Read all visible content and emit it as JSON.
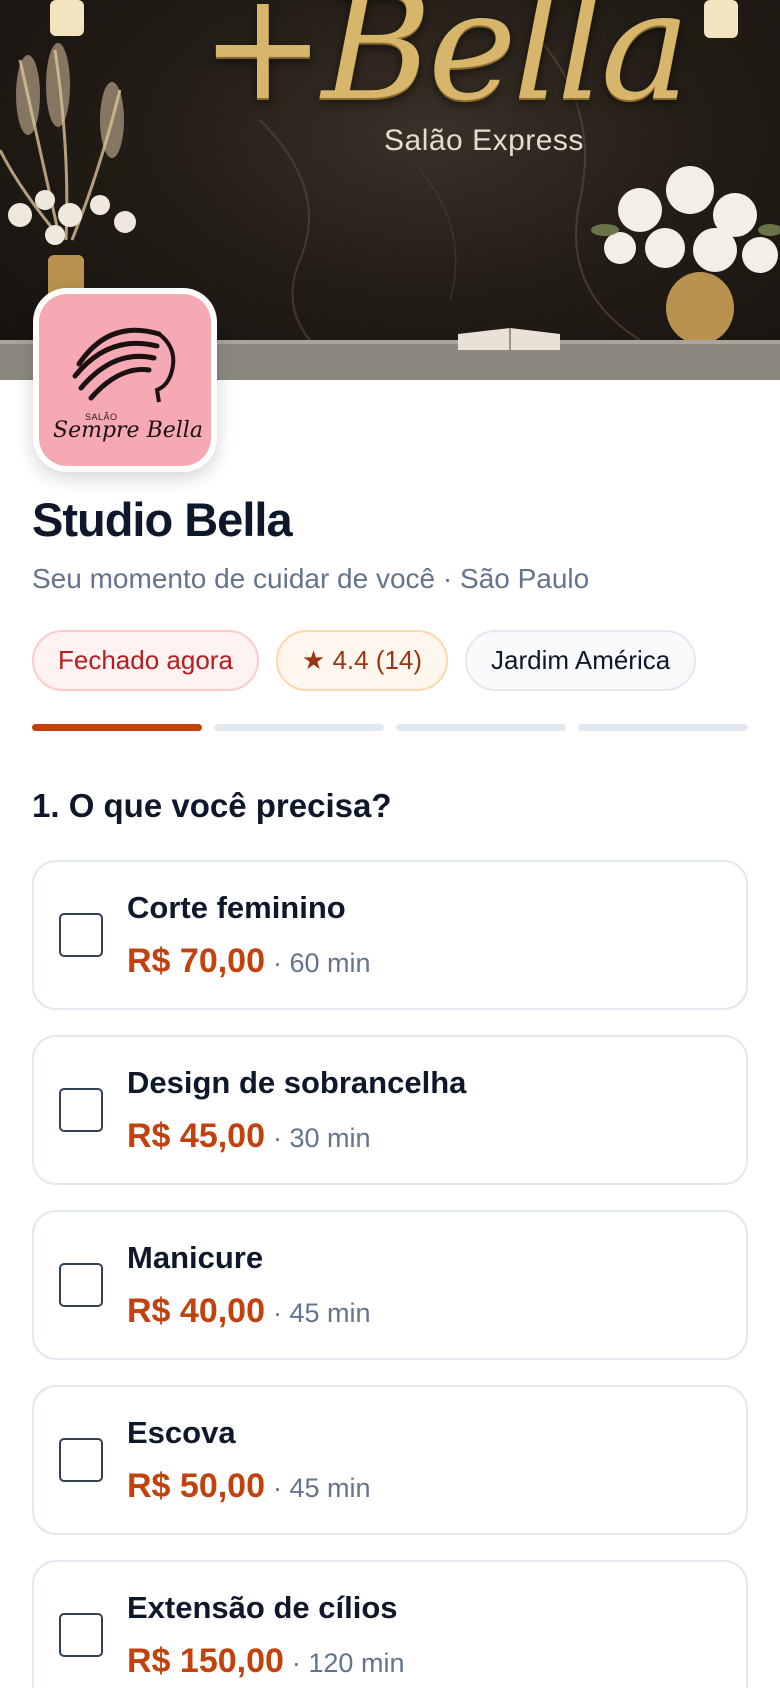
{
  "cover": {
    "brand_text": "+Bella",
    "brand_subtitle": "Salão Express"
  },
  "logo": {
    "small_text": "SALÃO",
    "name_text": "Sempre Bella",
    "background_color": "#f6a9b3"
  },
  "header": {
    "title": "Studio Bella",
    "subtitle": "Seu momento de cuidar de você · São Paulo",
    "chips": {
      "status": "Fechado agora",
      "rating": "★ 4.4 (14)",
      "neighborhood": "Jardim América"
    }
  },
  "progress": {
    "total_steps": 4,
    "current_step": 1
  },
  "section": {
    "title": "1. O que você precisa?"
  },
  "services": [
    {
      "name": "Corte feminino",
      "price": "R$ 70,00",
      "duration": "· 60 min",
      "checked": false
    },
    {
      "name": "Design de sobrancelha",
      "price": "R$ 45,00",
      "duration": "· 30 min",
      "checked": false
    },
    {
      "name": "Manicure",
      "price": "R$ 40,00",
      "duration": "· 45 min",
      "checked": false
    },
    {
      "name": "Escova",
      "price": "R$ 50,00",
      "duration": "· 45 min",
      "checked": false
    },
    {
      "name": "Extensão de cílios",
      "price": "R$ 150,00",
      "duration": "· 120 min",
      "checked": false
    }
  ],
  "colors": {
    "accent": "#c2410c",
    "closed_text": "#b91c1c",
    "muted_text": "#64748b",
    "title_text": "#0f172a"
  }
}
